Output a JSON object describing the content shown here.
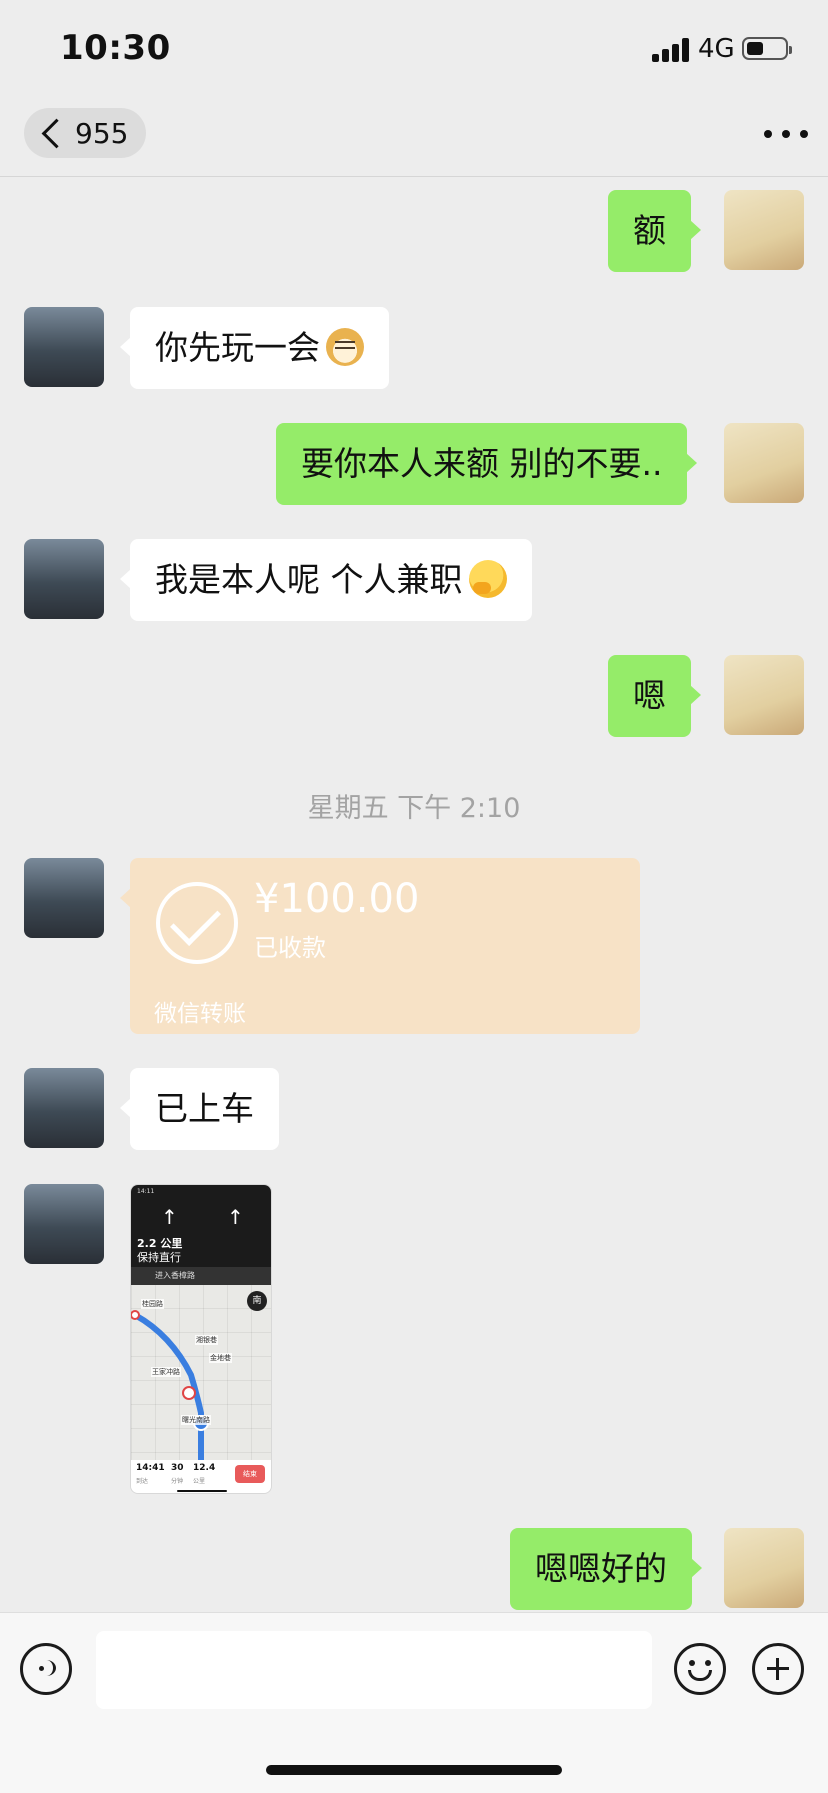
{
  "status_bar": {
    "time": "10:30",
    "network": "4G"
  },
  "nav": {
    "back_count": "955",
    "title": "",
    "more": "···"
  },
  "messages": {
    "m1": {
      "text": "额",
      "side": "right"
    },
    "m2": {
      "text": "你先玩一会",
      "side": "left",
      "emoji": "doge"
    },
    "m3": {
      "text": "要你本人来额 别的不要..",
      "side": "right"
    },
    "m4": {
      "text": "我是本人呢 个人兼职",
      "side": "left",
      "emoji": "smirk"
    },
    "m5": {
      "text": "嗯",
      "side": "right"
    },
    "m7": {
      "text": "已上车",
      "side": "left"
    },
    "m9": {
      "text": "嗯嗯好的",
      "side": "right"
    }
  },
  "timestamp": "星期五 下午 2:10",
  "transfer": {
    "amount": "¥100.00",
    "status": "已收款",
    "footer": "微信转账"
  },
  "nav_screenshot": {
    "status_time": "14:11",
    "distance": "2.2 公里",
    "instruction": "保持直行",
    "next": "进入香樟路",
    "compass": "南",
    "labels": [
      "桂园路",
      "湘银巷",
      "金地巷",
      "王家冲路",
      "曙光南路"
    ],
    "arrive_time": "14:41",
    "arrive_label": "到达",
    "minutes": "30",
    "minutes_label": "分钟",
    "km": "12.4",
    "km_label": "公里",
    "end_button": "结束"
  },
  "input_bar": {
    "placeholder": ""
  },
  "colors": {
    "chat_bg": "#ededed",
    "outgoing_bubble": "#95ec69",
    "incoming_bubble": "#ffffff",
    "transfer_card": "#f7e2c6"
  }
}
